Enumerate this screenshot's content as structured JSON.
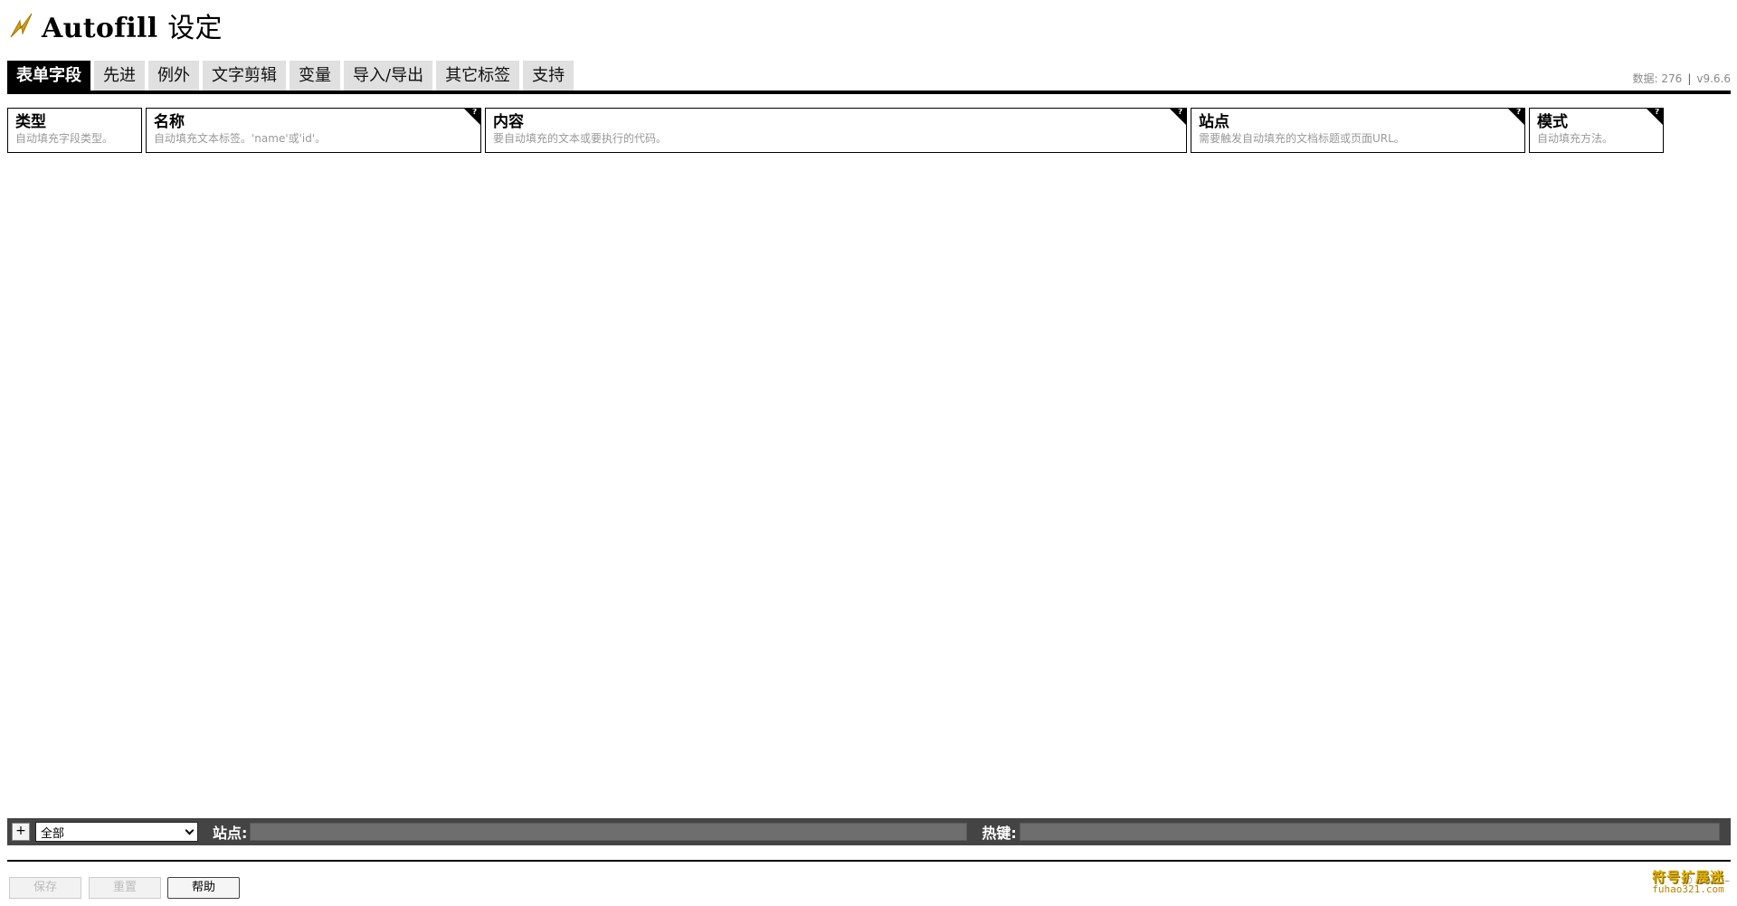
{
  "header": {
    "title_en": "Autofill",
    "title_cn": "设定",
    "logo_icon": "lightning-bolt-icon",
    "logo_color": "#d4a017"
  },
  "tabs": [
    {
      "label": "表单字段",
      "active": true
    },
    {
      "label": "先进"
    },
    {
      "label": "例外"
    },
    {
      "label": "文字剪辑"
    },
    {
      "label": "变量"
    },
    {
      "label": "导入/导出"
    },
    {
      "label": "其它标签"
    },
    {
      "label": "支持"
    }
  ],
  "meta": {
    "data_count": "数据: 276",
    "version": "v9.6.6"
  },
  "columns": [
    {
      "title": "类型",
      "desc": "自动填充字段类型。"
    },
    {
      "title": "名称",
      "desc": "自动填充文本标签。'name'或'id'。",
      "help": "?"
    },
    {
      "title": "内容",
      "desc": "要自动填充的文本或要执行的代码。",
      "help": "?"
    },
    {
      "title": "站点",
      "desc": "需要触发自动填充的文档标题或页面URL。",
      "help": "?"
    },
    {
      "title": "模式",
      "desc": "自动填充方法。",
      "help": "?"
    }
  ],
  "filterbar": {
    "add_label": "+",
    "profile_selected": "全部",
    "sites_label": "站点:",
    "sites_value": "",
    "hotkey_label": "热键:",
    "hotkey_value": ""
  },
  "buttons": {
    "save": "保存",
    "reset": "重置",
    "help": "帮助"
  },
  "footer": {
    "copyright": "© 2010–",
    "watermark_line1": "符号扩展迷",
    "watermark_line2": "fuhao321.com"
  }
}
